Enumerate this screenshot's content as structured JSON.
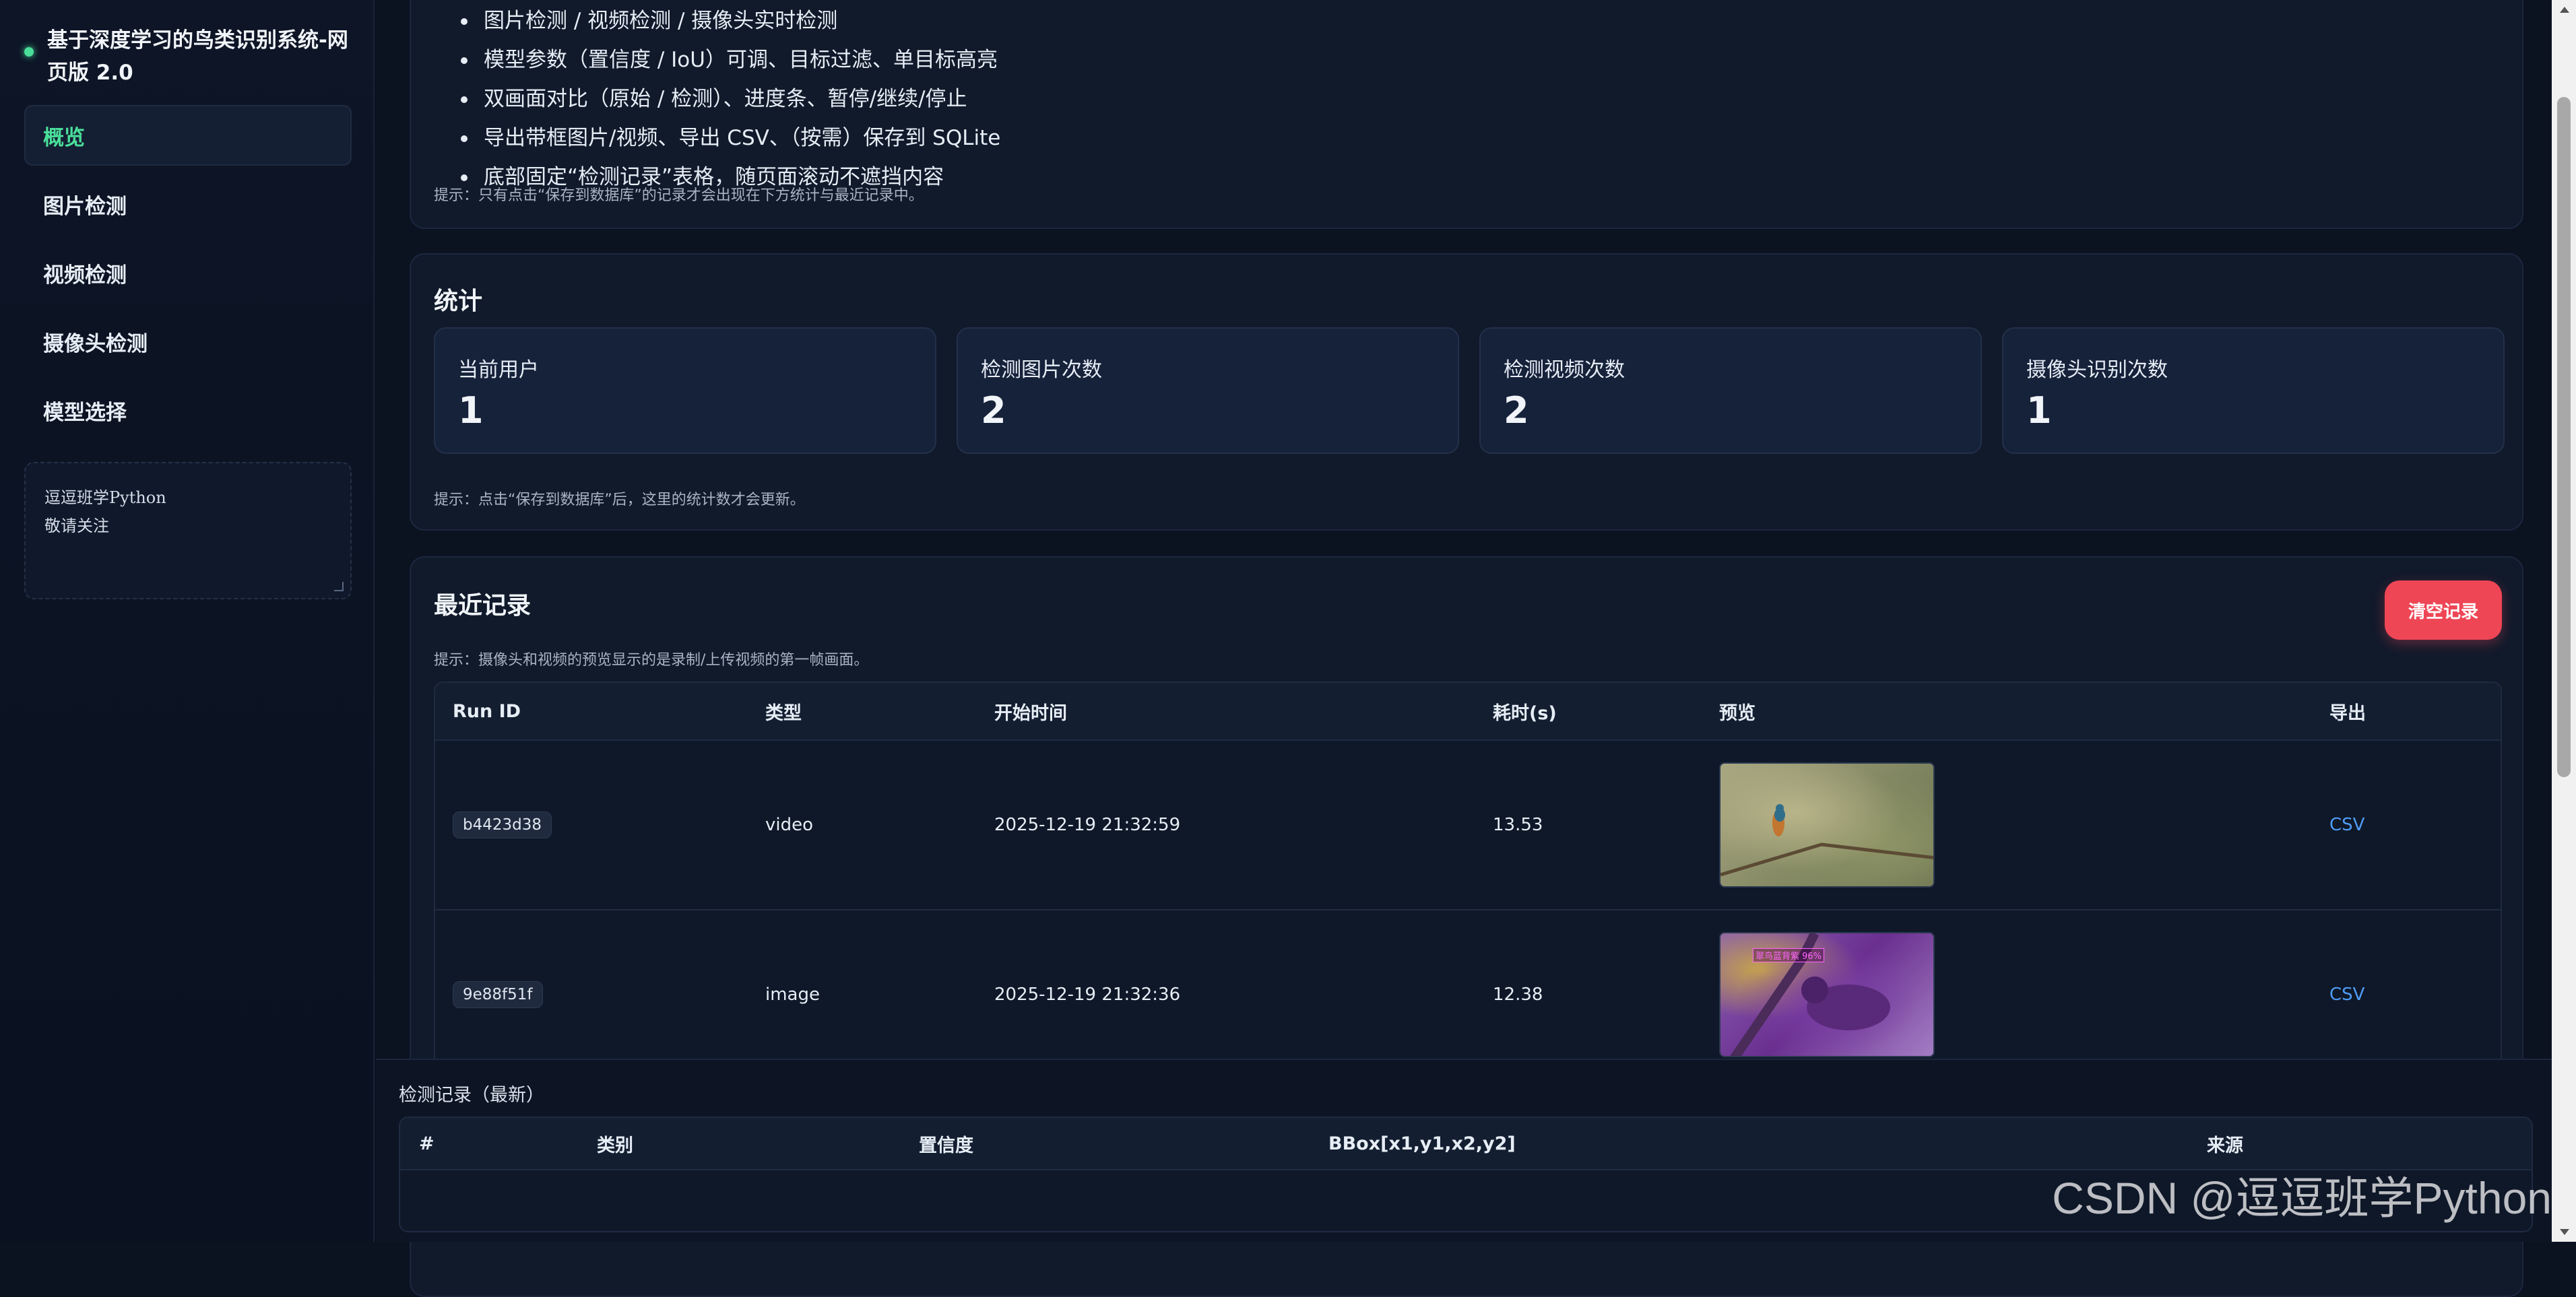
{
  "sidebar": {
    "title": "基于深度学习的鸟类识别系统-网页版 2.0",
    "nav": [
      {
        "label": "概览"
      },
      {
        "label": "图片检测"
      },
      {
        "label": "视频检测"
      },
      {
        "label": "摄像头检测"
      },
      {
        "label": "模型选择"
      }
    ],
    "note": "逗逗班学Python\n敬请关注"
  },
  "intro": {
    "features": [
      "图片检测 / 视频检测 / 摄像头实时检测",
      "模型参数（置信度 / IoU）可调、目标过滤、单目标高亮",
      "双画面对比（原始 / 检测）、进度条、暂停/继续/停止",
      "导出带框图片/视频、导出 CSV、（按需）保存到 SQLite",
      "底部固定“检测记录”表格，随页面滚动不遮挡内容"
    ],
    "hint": "提示：只有点击“保存到数据库”的记录才会出现在下方统计与最近记录中。"
  },
  "stats": {
    "title": "统计",
    "items": [
      {
        "label": "当前用户",
        "value": "1"
      },
      {
        "label": "检测图片次数",
        "value": "2"
      },
      {
        "label": "检测视频次数",
        "value": "2"
      },
      {
        "label": "摄像头识别次数",
        "value": "1"
      }
    ],
    "hint": "提示：点击“保存到数据库”后，这里的统计数才会更新。"
  },
  "records": {
    "title": "最近记录",
    "clear_label": "清空记录",
    "hint": "提示：摄像头和视频的预览显示的是录制/上传视频的第一帧画面。",
    "columns": [
      "Run ID",
      "类型",
      "开始时间",
      "耗时(s)",
      "预览",
      "导出"
    ],
    "rows": [
      {
        "id": "b4423d38",
        "type": "video",
        "start": "2025-12-19 21:32:59",
        "duration": "13.53",
        "export": "CSV"
      },
      {
        "id": "9e88f51f",
        "type": "image",
        "start": "2025-12-19 21:32:36",
        "duration": "12.38",
        "export": "CSV",
        "overlay": "翠鸟蓝背紫 96%"
      }
    ]
  },
  "detections": {
    "title": "检测记录（最新）",
    "columns": [
      "#",
      "类别",
      "置信度",
      "BBox[x1,y1,x2,y2]",
      "来源"
    ]
  },
  "watermark": "CSDN @逗逗班学Python",
  "colors": {
    "accent": "#4ade9a",
    "danger": "#ef4656",
    "link": "#4e9cf5",
    "background": "#0b1220"
  }
}
